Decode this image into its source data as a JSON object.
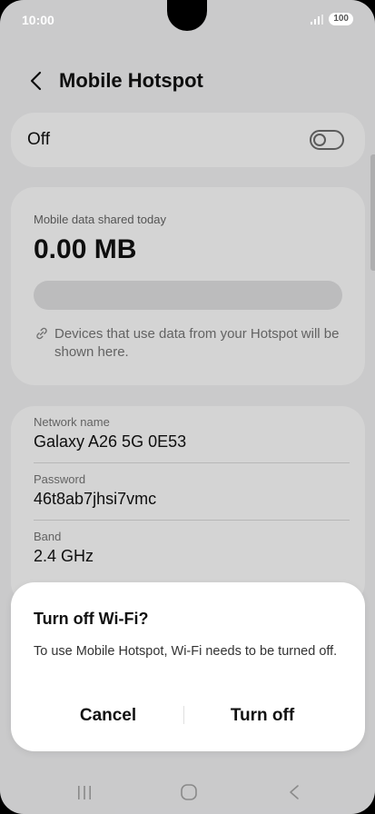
{
  "status": {
    "time": "10:00",
    "battery": "100"
  },
  "header": {
    "title": "Mobile Hotspot"
  },
  "hotspot_toggle": {
    "label": "Off",
    "on": false
  },
  "data_usage": {
    "caption": "Mobile data shared today",
    "value": "0.00 MB",
    "usage_fraction": 0,
    "devices_note": "Devices that use data from your Hotspot will be shown here."
  },
  "network": {
    "name_label": "Network name",
    "name_value": "Galaxy A26 5G 0E53",
    "password_label": "Password",
    "password_value": "46t8ab7jhsi7vmc",
    "band_label": "Band",
    "band_value": "2.4 GHz"
  },
  "dialog": {
    "title": "Turn off Wi-Fi?",
    "message": "To use Mobile Hotspot, Wi-Fi needs to be turned off.",
    "cancel_label": "Cancel",
    "confirm_label": "Turn off"
  },
  "colors": {
    "accent": "#3f7ee8",
    "background": "#f3f3f5",
    "card": "#ffffff"
  },
  "icons": {
    "back": "chevron-left-icon",
    "link": "link-icon",
    "nav_recent": "recent-apps-icon",
    "nav_home": "home-icon",
    "nav_back": "back-nav-icon"
  }
}
